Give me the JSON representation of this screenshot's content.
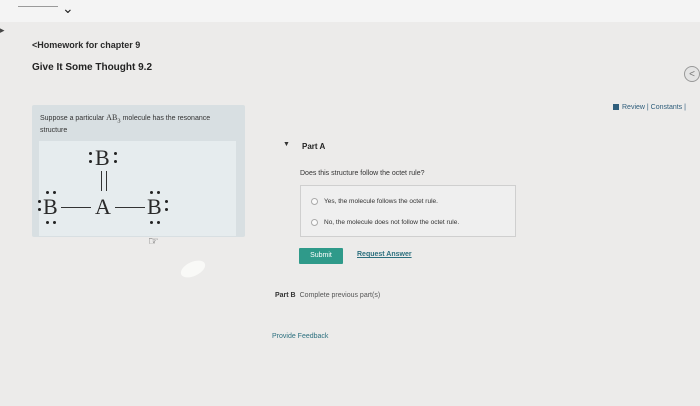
{
  "header": {
    "back_link": "<Homework for chapter 9",
    "title": "Give It Some Thought 9.2",
    "collapse_icon": "<",
    "review_link": "Review | Constants |"
  },
  "prompt": {
    "text_before": "Suppose a particular",
    "formula": "AB",
    "subscript": "3",
    "text_after": "molecule has the resonance structure",
    "structure_atoms": {
      "top": "B",
      "left": "B",
      "center": "A",
      "right": "B"
    }
  },
  "part_a": {
    "label": "Part A",
    "question": "Does this structure follow the octet rule?",
    "options": [
      "Yes, the molecule follows the octet rule.",
      "No, the molecule does not follow the octet rule."
    ],
    "submit_label": "Submit",
    "request_answer_label": "Request Answer"
  },
  "part_b": {
    "label": "Part B",
    "status": "Complete previous part(s)"
  },
  "footer": {
    "feedback_label": "Provide Feedback"
  }
}
